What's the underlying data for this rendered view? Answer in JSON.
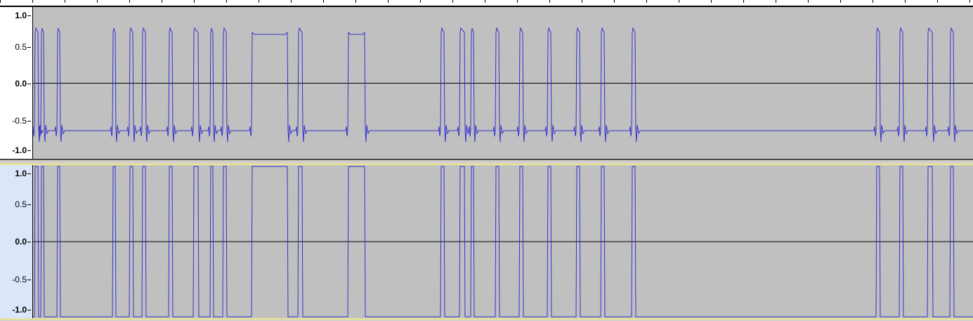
{
  "app": {
    "window": "Audio waveform editor - two tracks",
    "ticks": [
      "1.0",
      "0.5",
      "0.0",
      "-0.5",
      "-1.0"
    ]
  },
  "tracks": [
    {
      "id": "top",
      "kind": "noisy-digital",
      "low_level": -0.7,
      "high_level": 0.75,
      "plateau_level": 0.72,
      "waveform_color": "#3333cc"
    },
    {
      "id": "bottom",
      "kind": "clean-digital",
      "low_level": -1.0,
      "high_level": 1.0,
      "plateau_level": 1.0,
      "waveform_color": "#3333cc"
    }
  ],
  "pulses": [
    [
      2,
      8
    ],
    [
      11,
      16
    ],
    [
      34,
      39
    ],
    [
      113,
      118
    ],
    [
      137,
      143
    ],
    [
      155,
      161
    ],
    [
      193,
      199
    ],
    [
      228,
      236
    ],
    [
      252,
      257
    ],
    [
      270,
      276
    ],
    [
      311,
      363
    ],
    [
      377,
      384
    ],
    [
      448,
      473
    ],
    [
      580,
      586
    ],
    [
      607,
      615
    ],
    [
      623,
      628
    ],
    [
      658,
      664
    ],
    [
      692,
      698
    ],
    [
      732,
      738
    ],
    [
      773,
      779
    ],
    [
      808,
      814
    ],
    [
      852,
      858
    ],
    [
      1200,
      1206
    ],
    [
      1233,
      1239
    ],
    [
      1273,
      1281
    ],
    [
      1305,
      1311
    ]
  ],
  "colors": {
    "plot_bg": "#c0c0c0",
    "zero_line": "#000000",
    "waveform": "#3333cc"
  }
}
